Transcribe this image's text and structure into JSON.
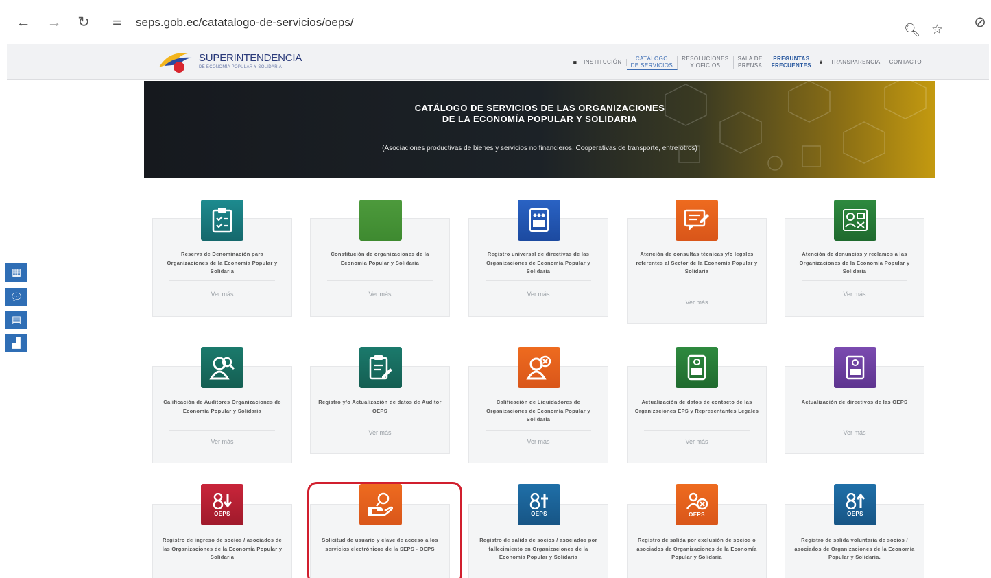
{
  "browser": {
    "url": "seps.gob.ec/catatalogo-de-servicios/oeps/"
  },
  "header": {
    "logo_title": "SUPERINTENDENCIA",
    "logo_subtitle": "DE ECONOMÍA POPULAR Y SOLIDARIA",
    "nav": {
      "institucion": "INSTITUCIÓN",
      "catalogo_1": "CATÁLOGO",
      "catalogo_2": "DE SERVICIOS",
      "resoluciones_1": "RESOLUCIONES",
      "resoluciones_2": "Y OFICIOS",
      "sala_1": "SALA DE",
      "sala_2": "PRENSA",
      "preguntas_1": "PREGUNTAS",
      "preguntas_2": "FRECUENTES",
      "transparencia": "TRANSPARENCIA",
      "contacto": "CONTACTO"
    }
  },
  "banner": {
    "title_line1": "CATÁLOGO DE SERVICIOS DE LAS ORGANIZACIONES",
    "title_line2": "DE LA ECONOMÍA POPULAR Y SOLIDARIA",
    "subtitle": "(Asociaciones productivas de bienes y servicios no financieros, Cooperativas de transporte, entre otros)"
  },
  "more_label": "Ver más",
  "oeps_label": "OEPS",
  "cards": [
    {
      "text": "Reserva de Denominación para Organizaciones de la Economía Popular y Solidaria",
      "icon": "clipboard-checklist-icon",
      "color": "#1d8b8f"
    },
    {
      "text": "Constitución de organizaciones de la Economía Popular y Solidaria",
      "icon": "blank-green-icon",
      "color": "#4d9a3c"
    },
    {
      "text": "Registro universal de directivas de las Organizaciones de Economía Popular y Solidaria",
      "icon": "oeps-group-icon",
      "color": "#2a63c4"
    },
    {
      "text": "Atención de consultas técnicas y/o legales referentes al Sector de la Economía Popular y Solidaria",
      "icon": "chat-document-icon",
      "color": "#ee6b1f"
    },
    {
      "text": "Atención de denuncias y reclamos a las Organizaciones de la Economía Popular y Solidaria",
      "icon": "complaint-form-icon",
      "color": "#2e8a3f"
    },
    {
      "text": "Calificación de Auditores Organizaciones de Economía Popular y Solidaria",
      "icon": "user-search-icon",
      "color": "#1b7a6c"
    },
    {
      "text": "Registro y/o Actualización de datos de Auditor OEPS",
      "icon": "clipboard-edit-icon",
      "color": "#1b7a6c"
    },
    {
      "text": "Calificación de Liquidadores de Organizaciones de Economía Popular y Solidaria",
      "icon": "user-remove-icon",
      "color": "#ee6b1f"
    },
    {
      "text": "Actualización de datos de contacto de las Organizaciones EPS y Representantes Legales",
      "icon": "contact-oeps-icon",
      "color": "#2e8a3f"
    },
    {
      "text": "Actualización de directivos de las OEPS",
      "icon": "directive-oeps-icon",
      "color": "#7b4bb0"
    },
    {
      "text": "Registro de ingreso de socios / asociados de las Organizaciones de la Economía Popular y Solidaria",
      "icon": "user-down-oeps-icon",
      "color": "#c9253a"
    },
    {
      "text": "Solicitud de usuario y clave de acceso a los servicios electrónicos de la SEPS - OEPS",
      "icon": "hand-key-icon",
      "color": "#ee6b1f"
    },
    {
      "text": "Registro de salida de socios / asociados por fallecimiento en Organizaciones de la Economía Popular y Solidaria",
      "icon": "user-cross-oeps-icon",
      "color": "#1f6fa8"
    },
    {
      "text": "Registro de salida por exclusión de socios o asociados de Organizaciones de la Economía Popular y Solidaria",
      "icon": "user-exclude-oeps-icon",
      "color": "#ee6b1f"
    },
    {
      "text": "Registro de salida voluntaria de socios / asociados de Organizaciones de la Economía Popular y Solidaria.",
      "icon": "user-up-oeps-icon",
      "color": "#1f6fa8"
    }
  ]
}
